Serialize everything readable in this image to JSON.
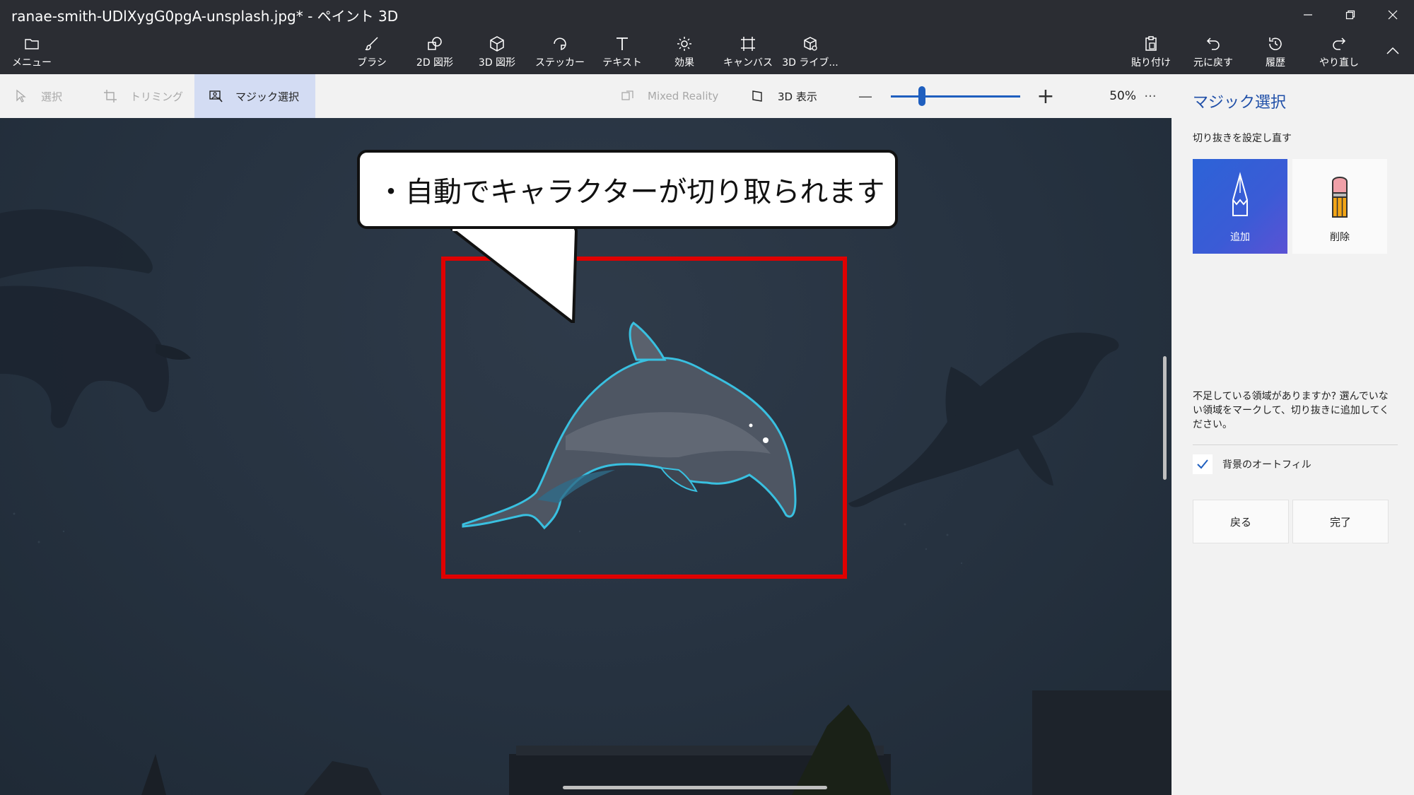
{
  "window": {
    "title": "ranae-smith-UDlXygG0pgA-unsplash.jpg* - ペイント 3D"
  },
  "toolbar": {
    "menu_label": "メニュー",
    "tools": [
      {
        "label": "ブラシ",
        "icon": "brush-icon"
      },
      {
        "label": "2D 図形",
        "icon": "2d-shapes-icon"
      },
      {
        "label": "3D 図形",
        "icon": "3d-shapes-icon"
      },
      {
        "label": "ステッカー",
        "icon": "sticker-icon"
      },
      {
        "label": "テキスト",
        "icon": "text-icon"
      },
      {
        "label": "効果",
        "icon": "effects-icon"
      },
      {
        "label": "キャンバス",
        "icon": "canvas-icon"
      },
      {
        "label": "3D ライブ...",
        "icon": "3d-library-icon"
      }
    ],
    "right_actions": [
      {
        "label": "貼り付け",
        "icon": "paste-icon"
      },
      {
        "label": "元に戻す",
        "icon": "undo-icon"
      },
      {
        "label": "履歴",
        "icon": "history-icon"
      },
      {
        "label": "やり直し",
        "icon": "redo-icon"
      }
    ]
  },
  "subbar": {
    "select_label": "選択",
    "crop_label": "トリミング",
    "magic_select_label": "マジック選択",
    "mixed_reality_label": "Mixed Reality",
    "view3d_label": "3D 表示",
    "zoom_minus": "—",
    "zoom_plus": "+",
    "zoom_value": "50%",
    "zoom_fraction": 0.24,
    "more_label": "···"
  },
  "panel": {
    "title": "マジック選択",
    "subtitle": "切り抜きを設定し直す",
    "add_label": "追加",
    "remove_label": "削除",
    "help_text": "不足している領域がありますか? 選んでいない領域をマークして、切り抜きに追加してください。",
    "autofill_label": "背景のオートフィル",
    "autofill_checked": true,
    "back_label": "戻る",
    "done_label": "完了"
  },
  "annotation": {
    "callout_text": "・自動でキャラクターが切り取られます",
    "highlight_color": "#e00000"
  },
  "colors": {
    "accent": "#1f5fbf",
    "titlebar": "#2b2d33",
    "outline": "#39c0e0"
  }
}
